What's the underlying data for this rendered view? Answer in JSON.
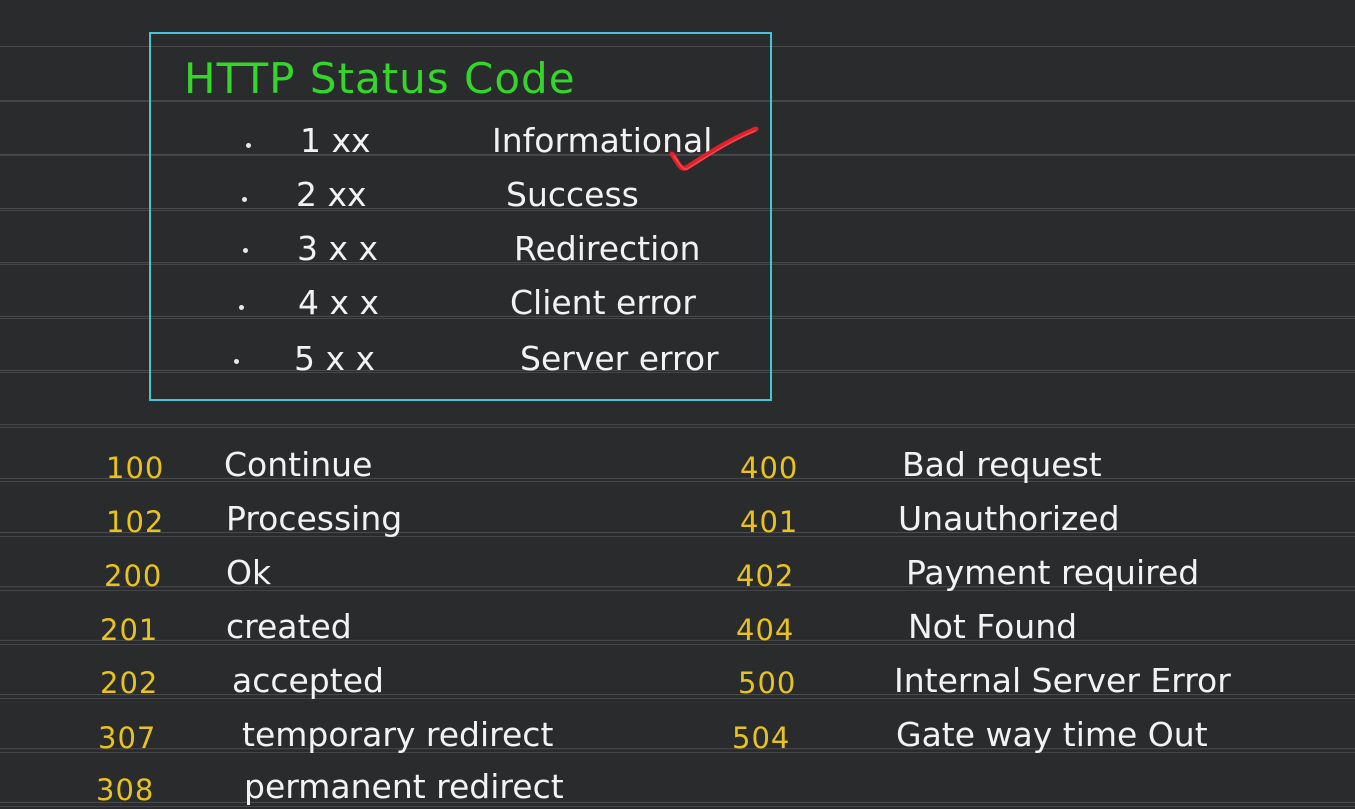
{
  "board": {
    "title": "HTTP Status Code",
    "classes": [
      {
        "code": "1 xx",
        "label": "Informational"
      },
      {
        "code": "2 xx",
        "label": "Success"
      },
      {
        "code": "3 x x",
        "label": "Redirection"
      },
      {
        "code": "4 x x",
        "label": "Client error"
      },
      {
        "code": "5 x x",
        "label": "Server error"
      }
    ]
  },
  "left_codes": [
    {
      "code": "100",
      "label": "Continue"
    },
    {
      "code": "102",
      "label": "Processing"
    },
    {
      "code": "200",
      "label": "Ok"
    },
    {
      "code": "201",
      "label": "created"
    },
    {
      "code": "202",
      "label": "accepted"
    },
    {
      "code": "307",
      "label": "temporary redirect"
    },
    {
      "code": "308",
      "label": "permanent redirect"
    }
  ],
  "right_codes": [
    {
      "code": "400",
      "label": "Bad request"
    },
    {
      "code": "401",
      "label": "Unauthorized"
    },
    {
      "code": "402",
      "label": "Payment required"
    },
    {
      "code": "404",
      "label": "Not Found"
    },
    {
      "code": "500",
      "label": "Internal Server Error"
    },
    {
      "code": "504",
      "label": "Gate way time Out"
    }
  ],
  "colors": {
    "background": "#2a2b2d",
    "box_border": "#47c4d6",
    "title": "#34d62a",
    "text": "#f2f2f2",
    "codes": "#e8c31c",
    "checkmark": "#e0202a"
  },
  "icons": {
    "checkmark": "red-checkmark-icon"
  }
}
